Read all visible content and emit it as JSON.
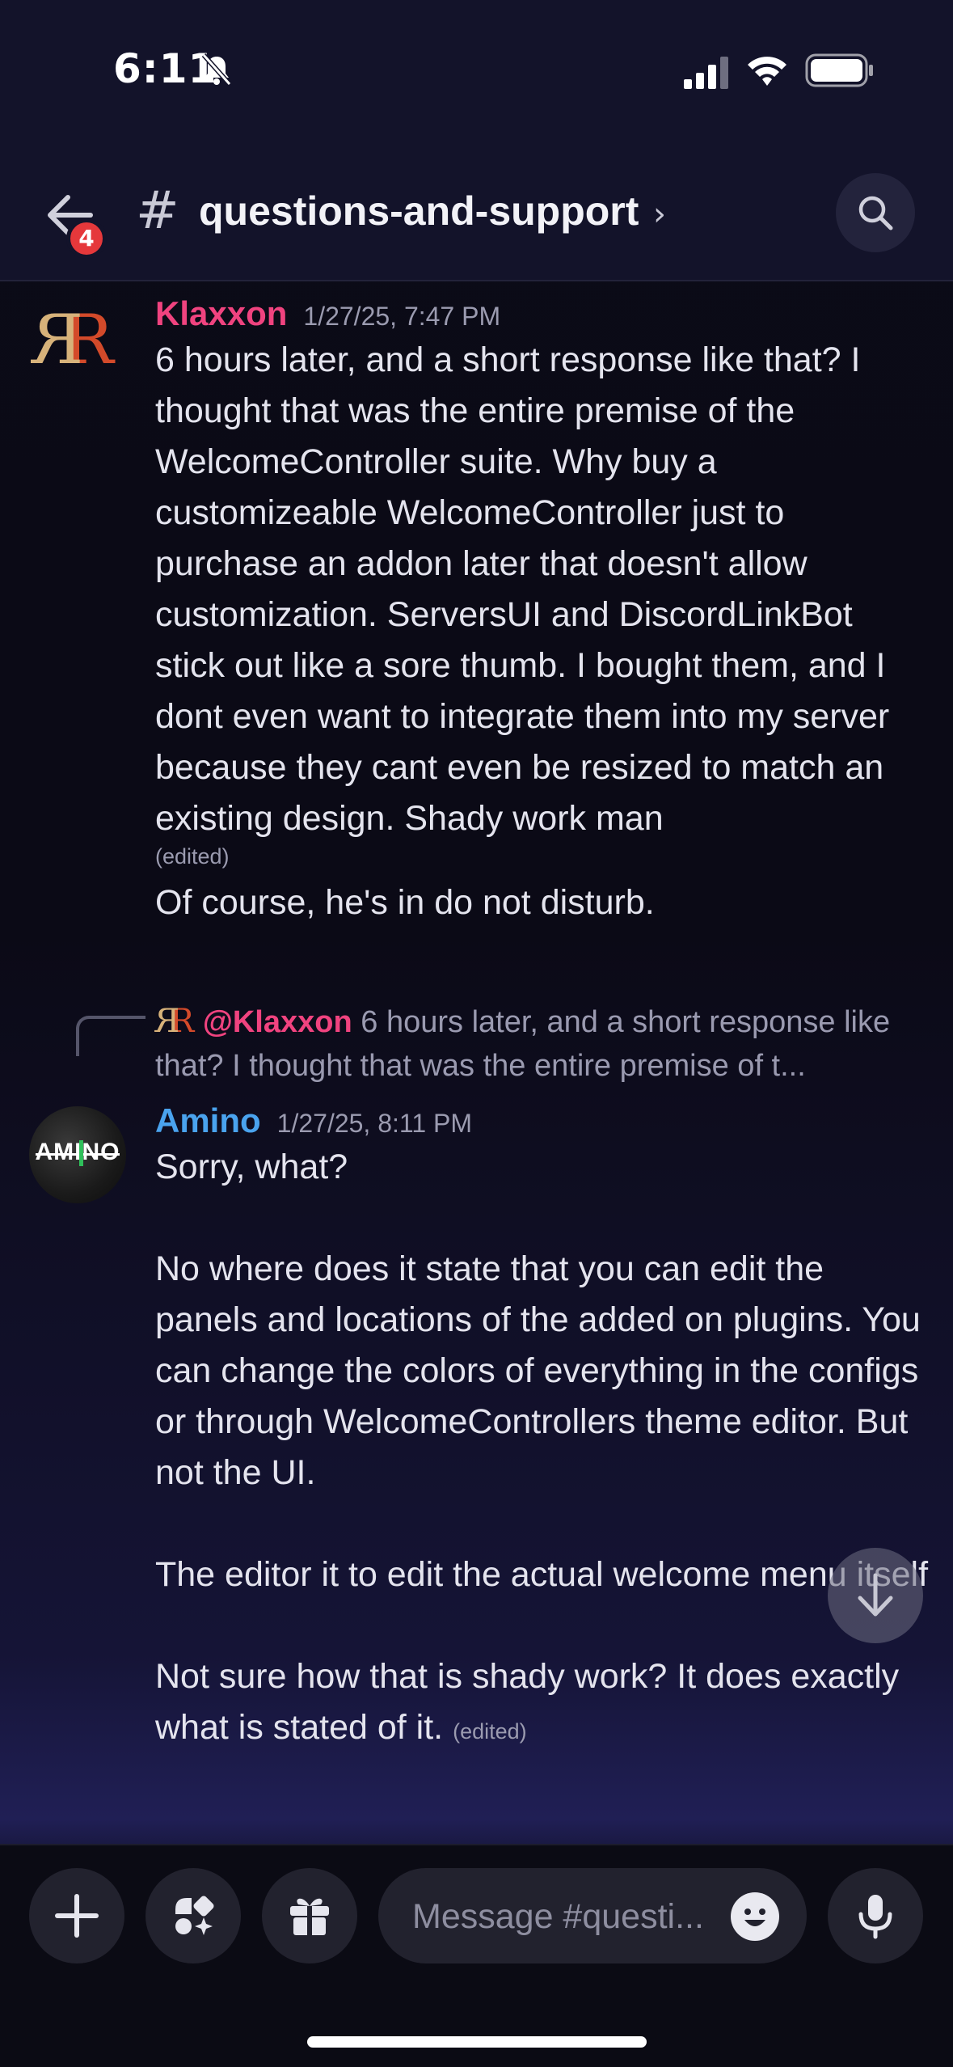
{
  "status_bar": {
    "time": "6:11"
  },
  "header": {
    "back_badge": "4",
    "hash": "#",
    "channel_name": "questions-and-support",
    "chevron": "›"
  },
  "messages": [
    {
      "author": "Klaxxon",
      "timestamp": "1/27/25, 7:47 PM",
      "text": "6 hours later, and a short response like that? I thought that was the entire premise of the WelcomeController suite. Why buy a customizeable WelcomeController just to purchase an addon later that doesn't allow customization. ServersUI and DiscordLinkBot stick out like a sore thumb. I bought them, and I dont even want to integrate them into my server because they cant even be resized to match an existing design. Shady work man",
      "edited_label": "(edited)",
      "followup": "Of course, he's in do not disturb."
    },
    {
      "reply": {
        "author": "@Klaxxon",
        "preview": "6 hours later, and a short response like that? I thought that was the entire premise of t..."
      },
      "author": "Amino",
      "avatar_text": "AMINO",
      "timestamp": "1/27/25, 8:11 PM",
      "text": "Sorry, what?\n\nNo where does it state that you can edit the panels and locations of the added on plugins. You can change the colors of everything in the configs or through WelcomeControllers theme editor. But not the UI.\n\nThe editor it to edit the actual welcome menu itself\n\nNot sure how that is shady work? It does exactly what is stated of it.",
      "edited_label": "(edited)"
    }
  ],
  "composer": {
    "placeholder": "Message #questi..."
  },
  "colors": {
    "klaxxon": "#f0437f",
    "amino": "#4aa3ee",
    "badge": "#e5383b"
  },
  "icons": [
    "bell-slash-icon",
    "signal-icon",
    "wifi-icon",
    "battery-icon",
    "back-arrow-icon",
    "search-icon",
    "arrow-down-icon",
    "plus-icon",
    "apps-icon",
    "gift-icon",
    "emoji-icon",
    "microphone-icon"
  ]
}
